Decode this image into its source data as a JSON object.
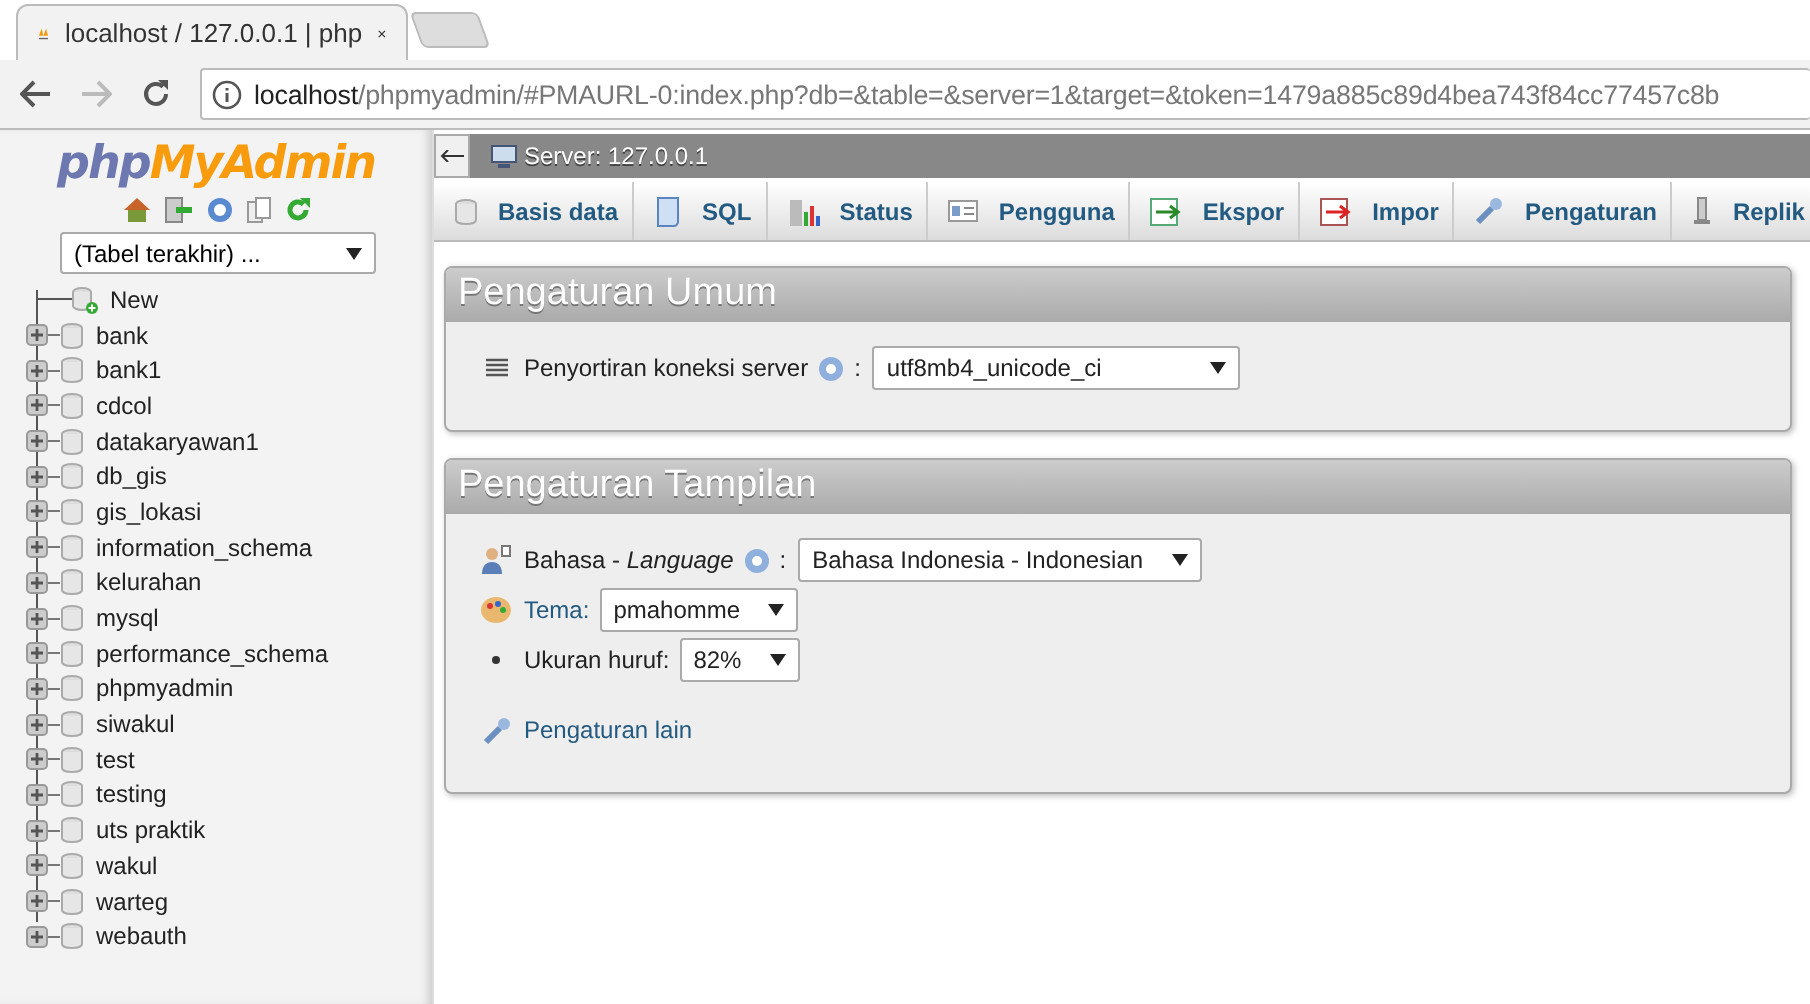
{
  "browser": {
    "tab": {
      "title": "localhost / 127.0.0.1 | php"
    },
    "address": {
      "host": "localhost",
      "path": "/phpmyadmin/#PMAURL-0:index.php?db=&table=&server=1&target=&token=1479a885c89d4bea743f84cc77457c8b"
    }
  },
  "sidebar": {
    "logo": {
      "part1": "php",
      "part2": "MyAdmin"
    },
    "recent_select": {
      "value": "(Tabel terakhir) ..."
    },
    "tree": [
      {
        "label": "New",
        "kind": "new"
      },
      {
        "label": "bank",
        "kind": "database"
      },
      {
        "label": "bank1",
        "kind": "database"
      },
      {
        "label": "cdcol",
        "kind": "database"
      },
      {
        "label": "datakaryawan1",
        "kind": "database"
      },
      {
        "label": "db_gis",
        "kind": "database"
      },
      {
        "label": "gis_lokasi",
        "kind": "database"
      },
      {
        "label": "information_schema",
        "kind": "database"
      },
      {
        "label": "kelurahan",
        "kind": "database"
      },
      {
        "label": "mysql",
        "kind": "database"
      },
      {
        "label": "performance_schema",
        "kind": "database"
      },
      {
        "label": "phpmyadmin",
        "kind": "database"
      },
      {
        "label": "siwakul",
        "kind": "database"
      },
      {
        "label": "test",
        "kind": "database"
      },
      {
        "label": "testing",
        "kind": "database"
      },
      {
        "label": "uts praktik",
        "kind": "database"
      },
      {
        "label": "wakul",
        "kind": "database"
      },
      {
        "label": "warteg",
        "kind": "database"
      },
      {
        "label": "webauth",
        "kind": "database"
      }
    ]
  },
  "server_bar": {
    "title": "Server: 127.0.0.1"
  },
  "tabs": [
    {
      "label": "Basis data"
    },
    {
      "label": "SQL"
    },
    {
      "label": "Status"
    },
    {
      "label": "Pengguna"
    },
    {
      "label": "Ekspor"
    },
    {
      "label": "Impor"
    },
    {
      "label": "Pengaturan"
    },
    {
      "label": "Replik"
    }
  ],
  "panels": [
    {
      "title": "Pengaturan Umum",
      "rows": [
        {
          "kind": "select",
          "label": "Penyortiran koneksi server",
          "help": true,
          "separator": ":",
          "value": "utf8mb4_unicode_ci"
        }
      ]
    },
    {
      "title": "Pengaturan Tampilan",
      "rows": [
        {
          "kind": "select",
          "label": "Bahasa - *Language*",
          "help": true,
          "separator": ":",
          "value": "Bahasa Indonesia - Indonesian"
        },
        {
          "kind": "link-select",
          "label": "Tema:",
          "value": "pmahomme"
        },
        {
          "kind": "bullet-select",
          "label": "Ukuran huruf:",
          "value": "82%"
        },
        {
          "kind": "link",
          "label": "Pengaturan lain"
        }
      ]
    }
  ]
}
